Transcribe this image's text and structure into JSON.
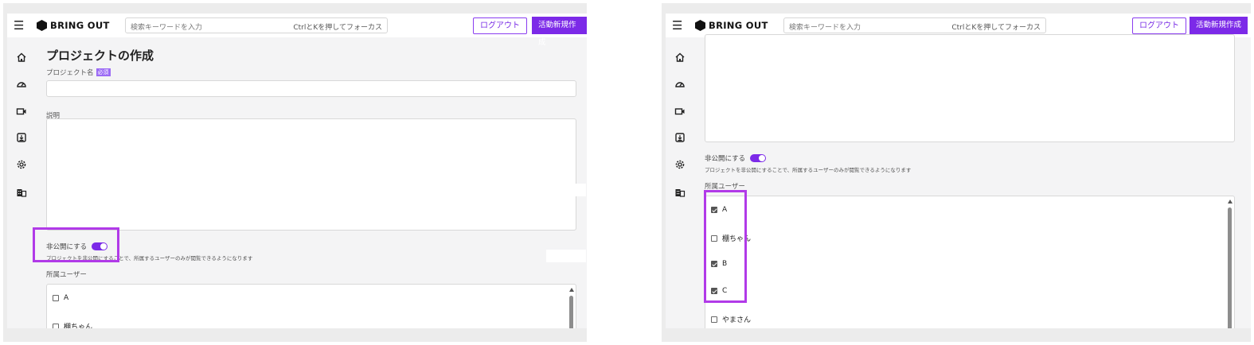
{
  "header": {
    "logo_text": "BRING OUT",
    "search_placeholder": "検索キーワードを入力",
    "search_hint": "CtrlとKを押してフォーカス",
    "logout_label": "ログアウト",
    "new_activity_label": "活動新規作成"
  },
  "sidebar": {
    "icons": [
      "home-icon",
      "dashboard-gauge-icon",
      "video-camera-icon",
      "download-box-icon",
      "settings-gear-icon",
      "building-icon"
    ]
  },
  "form": {
    "page_title": "プロジェクトの作成",
    "project_name_label": "プロジェクト名",
    "required_badge": "必須",
    "description_label": "説明",
    "private_label": "非公開にする",
    "private_enabled": true,
    "private_description": "プロジェクトを非公開にすることで、所属するユーザーのみが閲覧できるようになります",
    "members_label": "所属ユーザー"
  },
  "left_users": [
    {
      "name": "A",
      "checked": false
    },
    {
      "name": "棚ちゃん",
      "checked": false
    }
  ],
  "right_users": [
    {
      "name": "A",
      "checked": true
    },
    {
      "name": "棚ちゃん",
      "checked": false
    },
    {
      "name": "B",
      "checked": true
    },
    {
      "name": "C",
      "checked": true
    },
    {
      "name": "やまさん",
      "checked": false
    }
  ],
  "colors": {
    "accent": "#7c2ae8",
    "highlight": "#b13ae8"
  }
}
